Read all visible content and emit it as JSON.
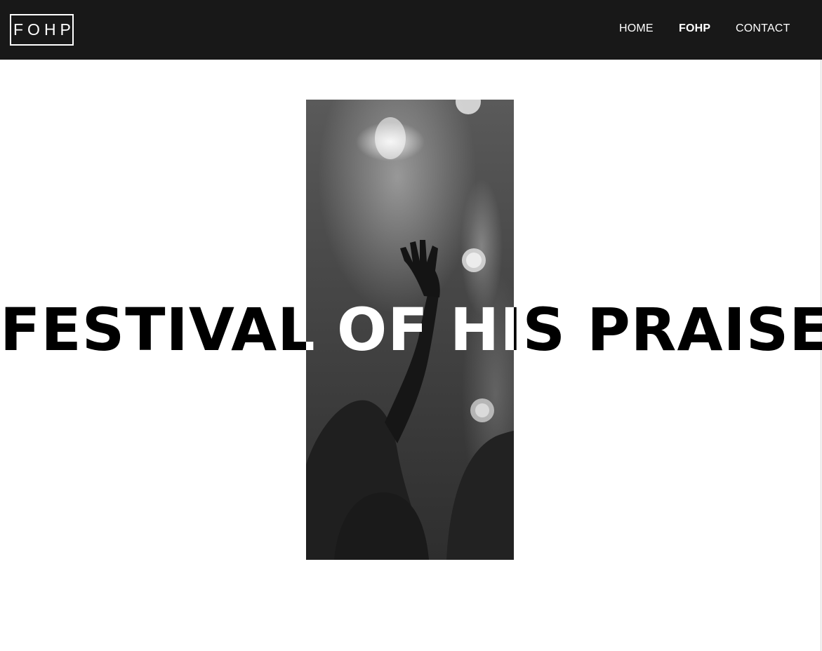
{
  "header": {
    "logo_text": "FOHP",
    "nav": [
      {
        "label": "HOME",
        "active": false
      },
      {
        "label": "FOHP",
        "active": true
      },
      {
        "label": "CONTACT",
        "active": false
      }
    ]
  },
  "hero": {
    "title": "FESTIVAL OF HIS PRAISE",
    "image_icon": "worship-concert-photo"
  },
  "colors": {
    "header_bg": "#181818",
    "header_text": "#ffffff",
    "page_bg": "#ffffff",
    "title_dark": "#000000",
    "title_light": "#ffffff"
  }
}
